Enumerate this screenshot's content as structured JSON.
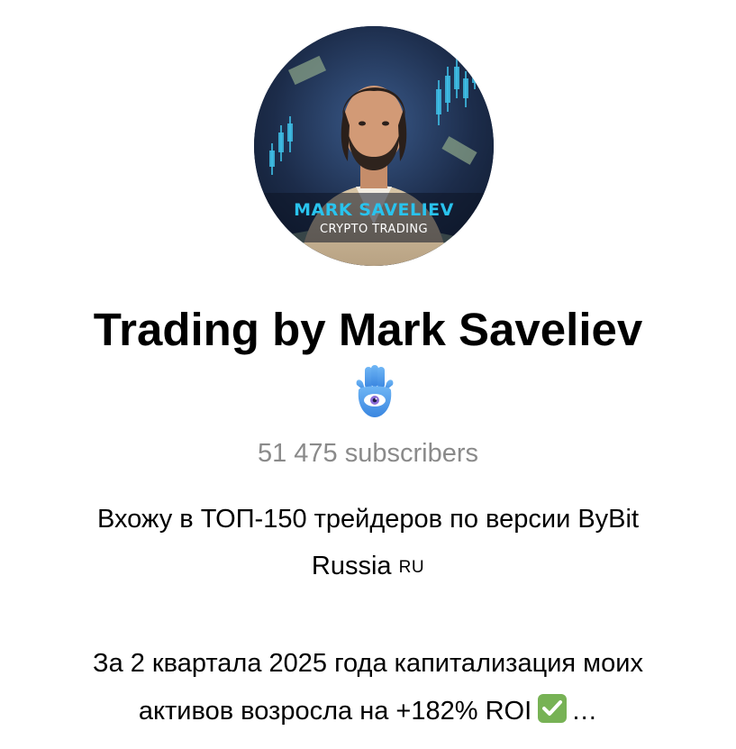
{
  "channel": {
    "avatar": {
      "name_text": "MARK SAVELIEV",
      "sub_text": "CRYPTO TRADING"
    },
    "title": "Trading by Mark Saveliev",
    "badge_icon": "hamsa-eye-icon",
    "subscribers": "51 475 subscribers",
    "description": {
      "line1": "Вхожу в ТОП-150 трейдеров по версии ByBit",
      "line2": "Russia",
      "line2_flag": "RU",
      "line3": "За 2 квартала 2025 года капитализация моих",
      "line4": "активов возросла на +182% ROI",
      "line4_icon": "check-mark-button-icon",
      "ellipsis": "…"
    }
  },
  "colors": {
    "accent_cyan": "#29c3ee",
    "subscribers_gray": "#8a8a8a",
    "check_green": "#77b255",
    "badge_blue": "#5aa8f0"
  }
}
